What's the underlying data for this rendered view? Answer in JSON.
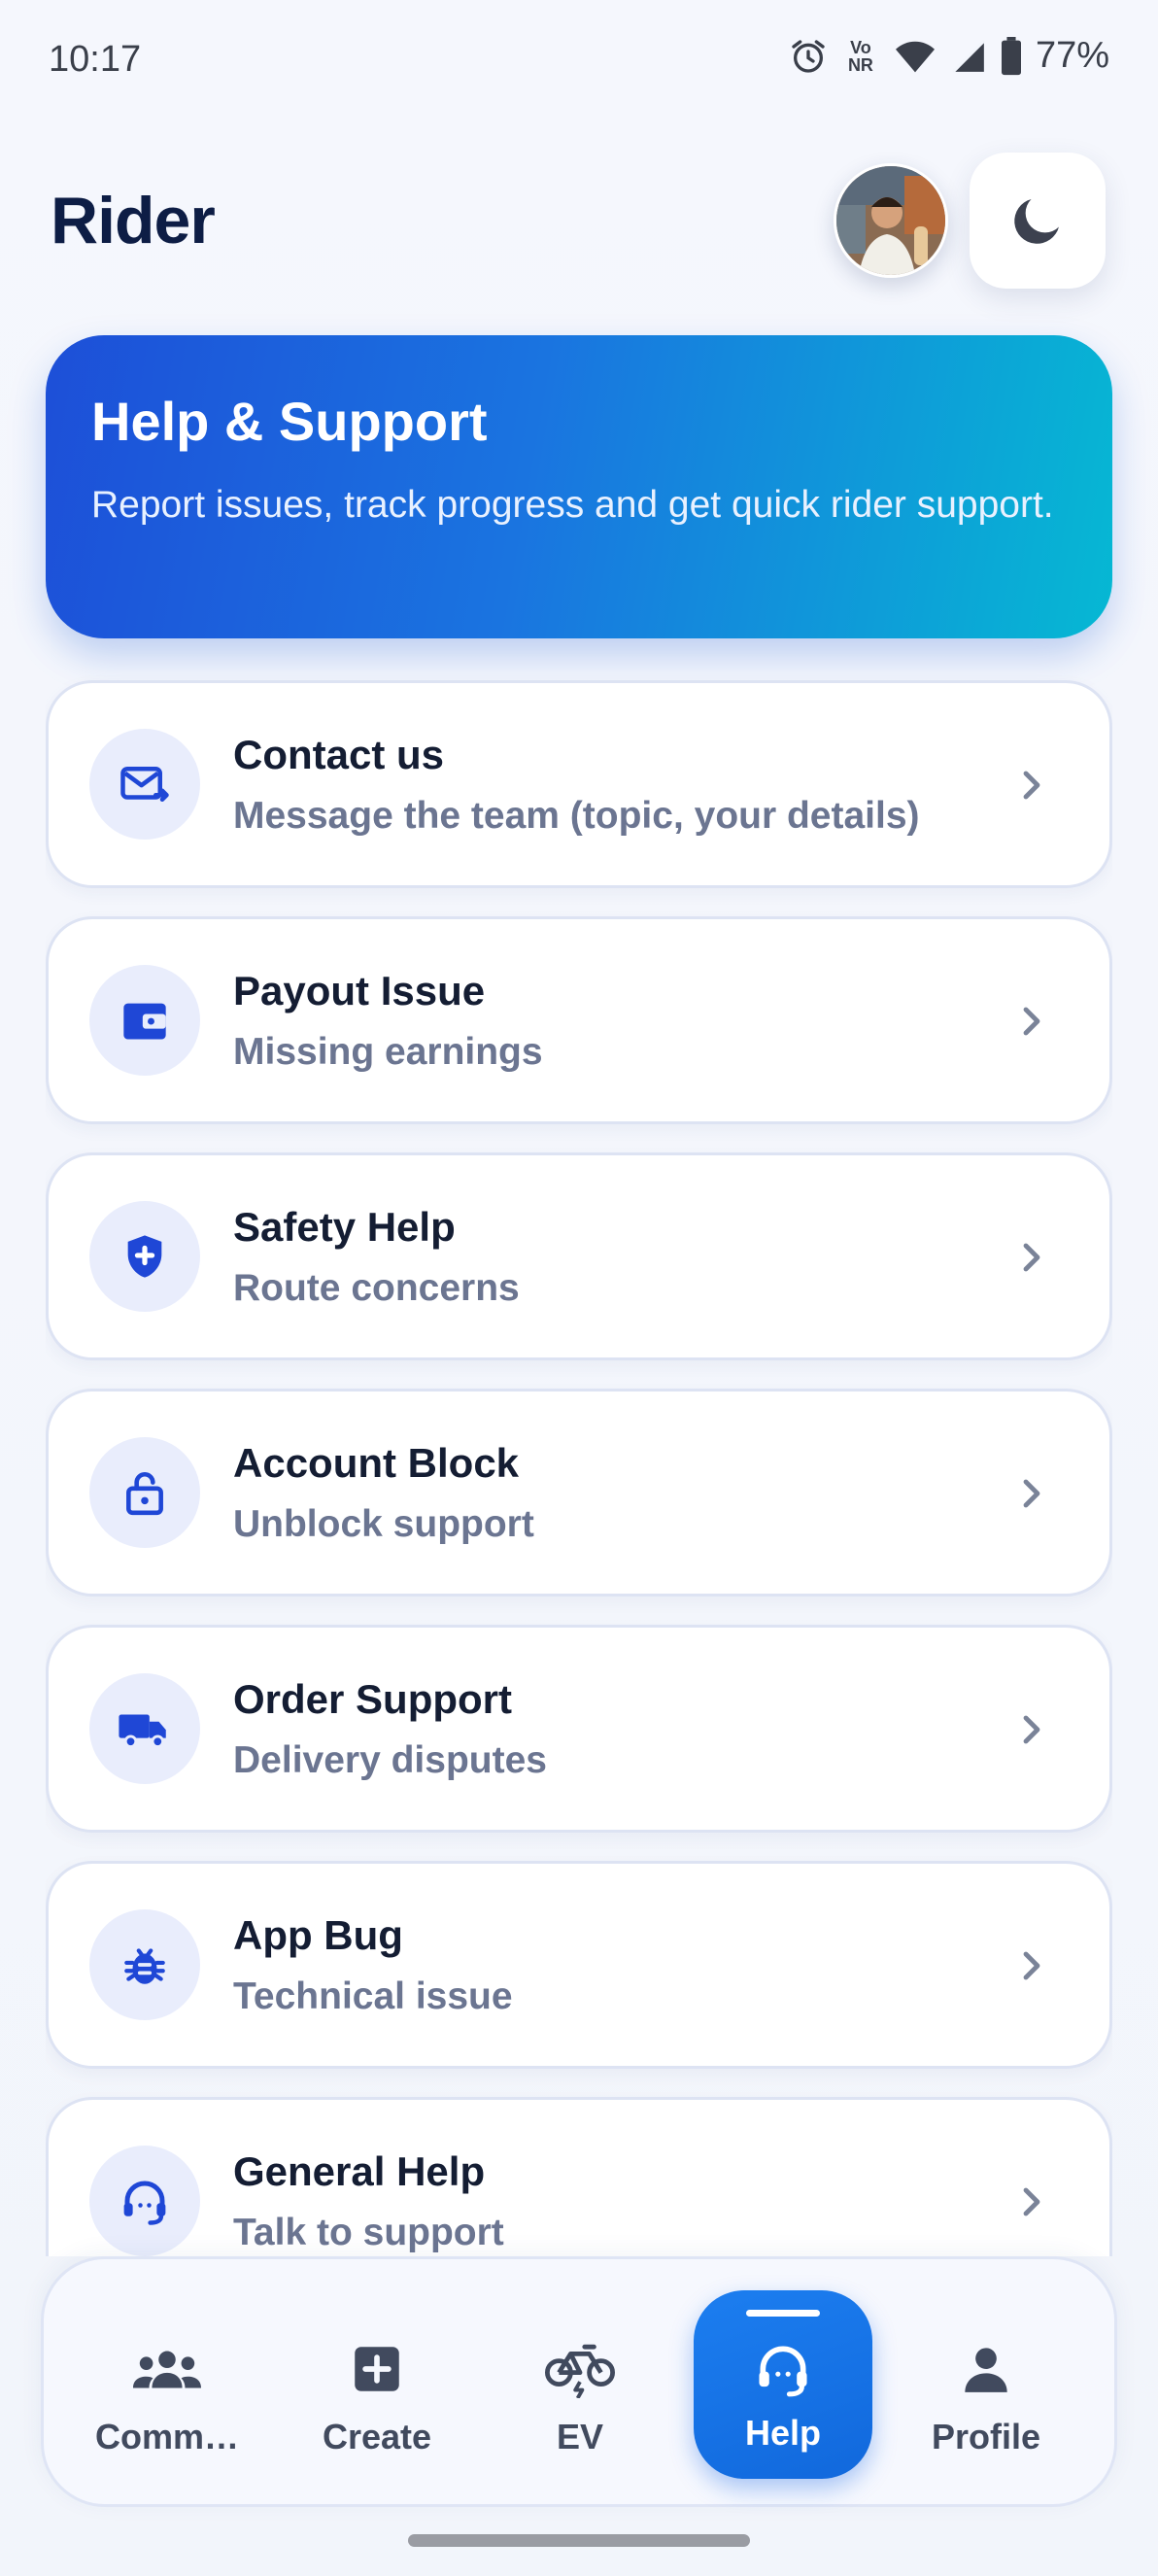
{
  "status_bar": {
    "time": "10:17",
    "network_badge_top": "Vo",
    "network_badge_bottom": "NR",
    "battery": "77%"
  },
  "header": {
    "title": "Rider",
    "theme_icon": "moon-icon"
  },
  "hero": {
    "title": "Help & Support",
    "subtitle": "Report issues, track progress and get quick rider support."
  },
  "items": [
    {
      "title": "Contact us",
      "subtitle": "Message the team (topic, your details)",
      "icon": "mail-icon"
    },
    {
      "title": "Payout Issue",
      "subtitle": "Missing earnings",
      "icon": "wallet-icon"
    },
    {
      "title": "Safety Help",
      "subtitle": "Route concerns",
      "icon": "shield-icon"
    },
    {
      "title": "Account Block",
      "subtitle": "Unblock support",
      "icon": "lock-icon"
    },
    {
      "title": "Order Support",
      "subtitle": "Delivery disputes",
      "icon": "truck-icon"
    },
    {
      "title": "App Bug",
      "subtitle": "Technical issue",
      "icon": "bug-icon"
    },
    {
      "title": "General Help",
      "subtitle": "Talk to support",
      "icon": "headset-icon"
    }
  ],
  "nav": [
    {
      "label": "Comm…",
      "icon": "community-icon"
    },
    {
      "label": "Create",
      "icon": "add-box-icon"
    },
    {
      "label": "EV",
      "icon": "ebike-icon"
    },
    {
      "label": "Help",
      "icon": "headset-icon",
      "active": true
    },
    {
      "label": "Profile",
      "icon": "person-icon"
    }
  ],
  "colors": {
    "accent": "#1d4fd8",
    "hero_end": "#06b8d3",
    "icon_blue": "#1f47d6",
    "active_nav": "#1478ea"
  }
}
